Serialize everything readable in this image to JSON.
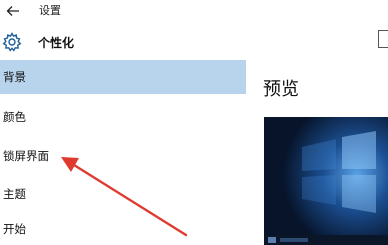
{
  "window": {
    "title": "设置",
    "back_icon": "back-arrow-icon"
  },
  "sidebar": {
    "header": {
      "icon": "gear-icon",
      "label": "个性化"
    },
    "items": [
      {
        "label": "背景",
        "selected": true
      },
      {
        "label": "颜色",
        "selected": false
      },
      {
        "label": "锁屏界面",
        "selected": false
      },
      {
        "label": "主题",
        "selected": false
      },
      {
        "label": "开始",
        "selected": false
      }
    ]
  },
  "main": {
    "section_title": "预览"
  },
  "colors": {
    "selection": "#b8d4ec",
    "annotation_arrow": "#e03a2f",
    "preview_dark": "#0a1a33",
    "preview_light": "#2f6fb8"
  }
}
